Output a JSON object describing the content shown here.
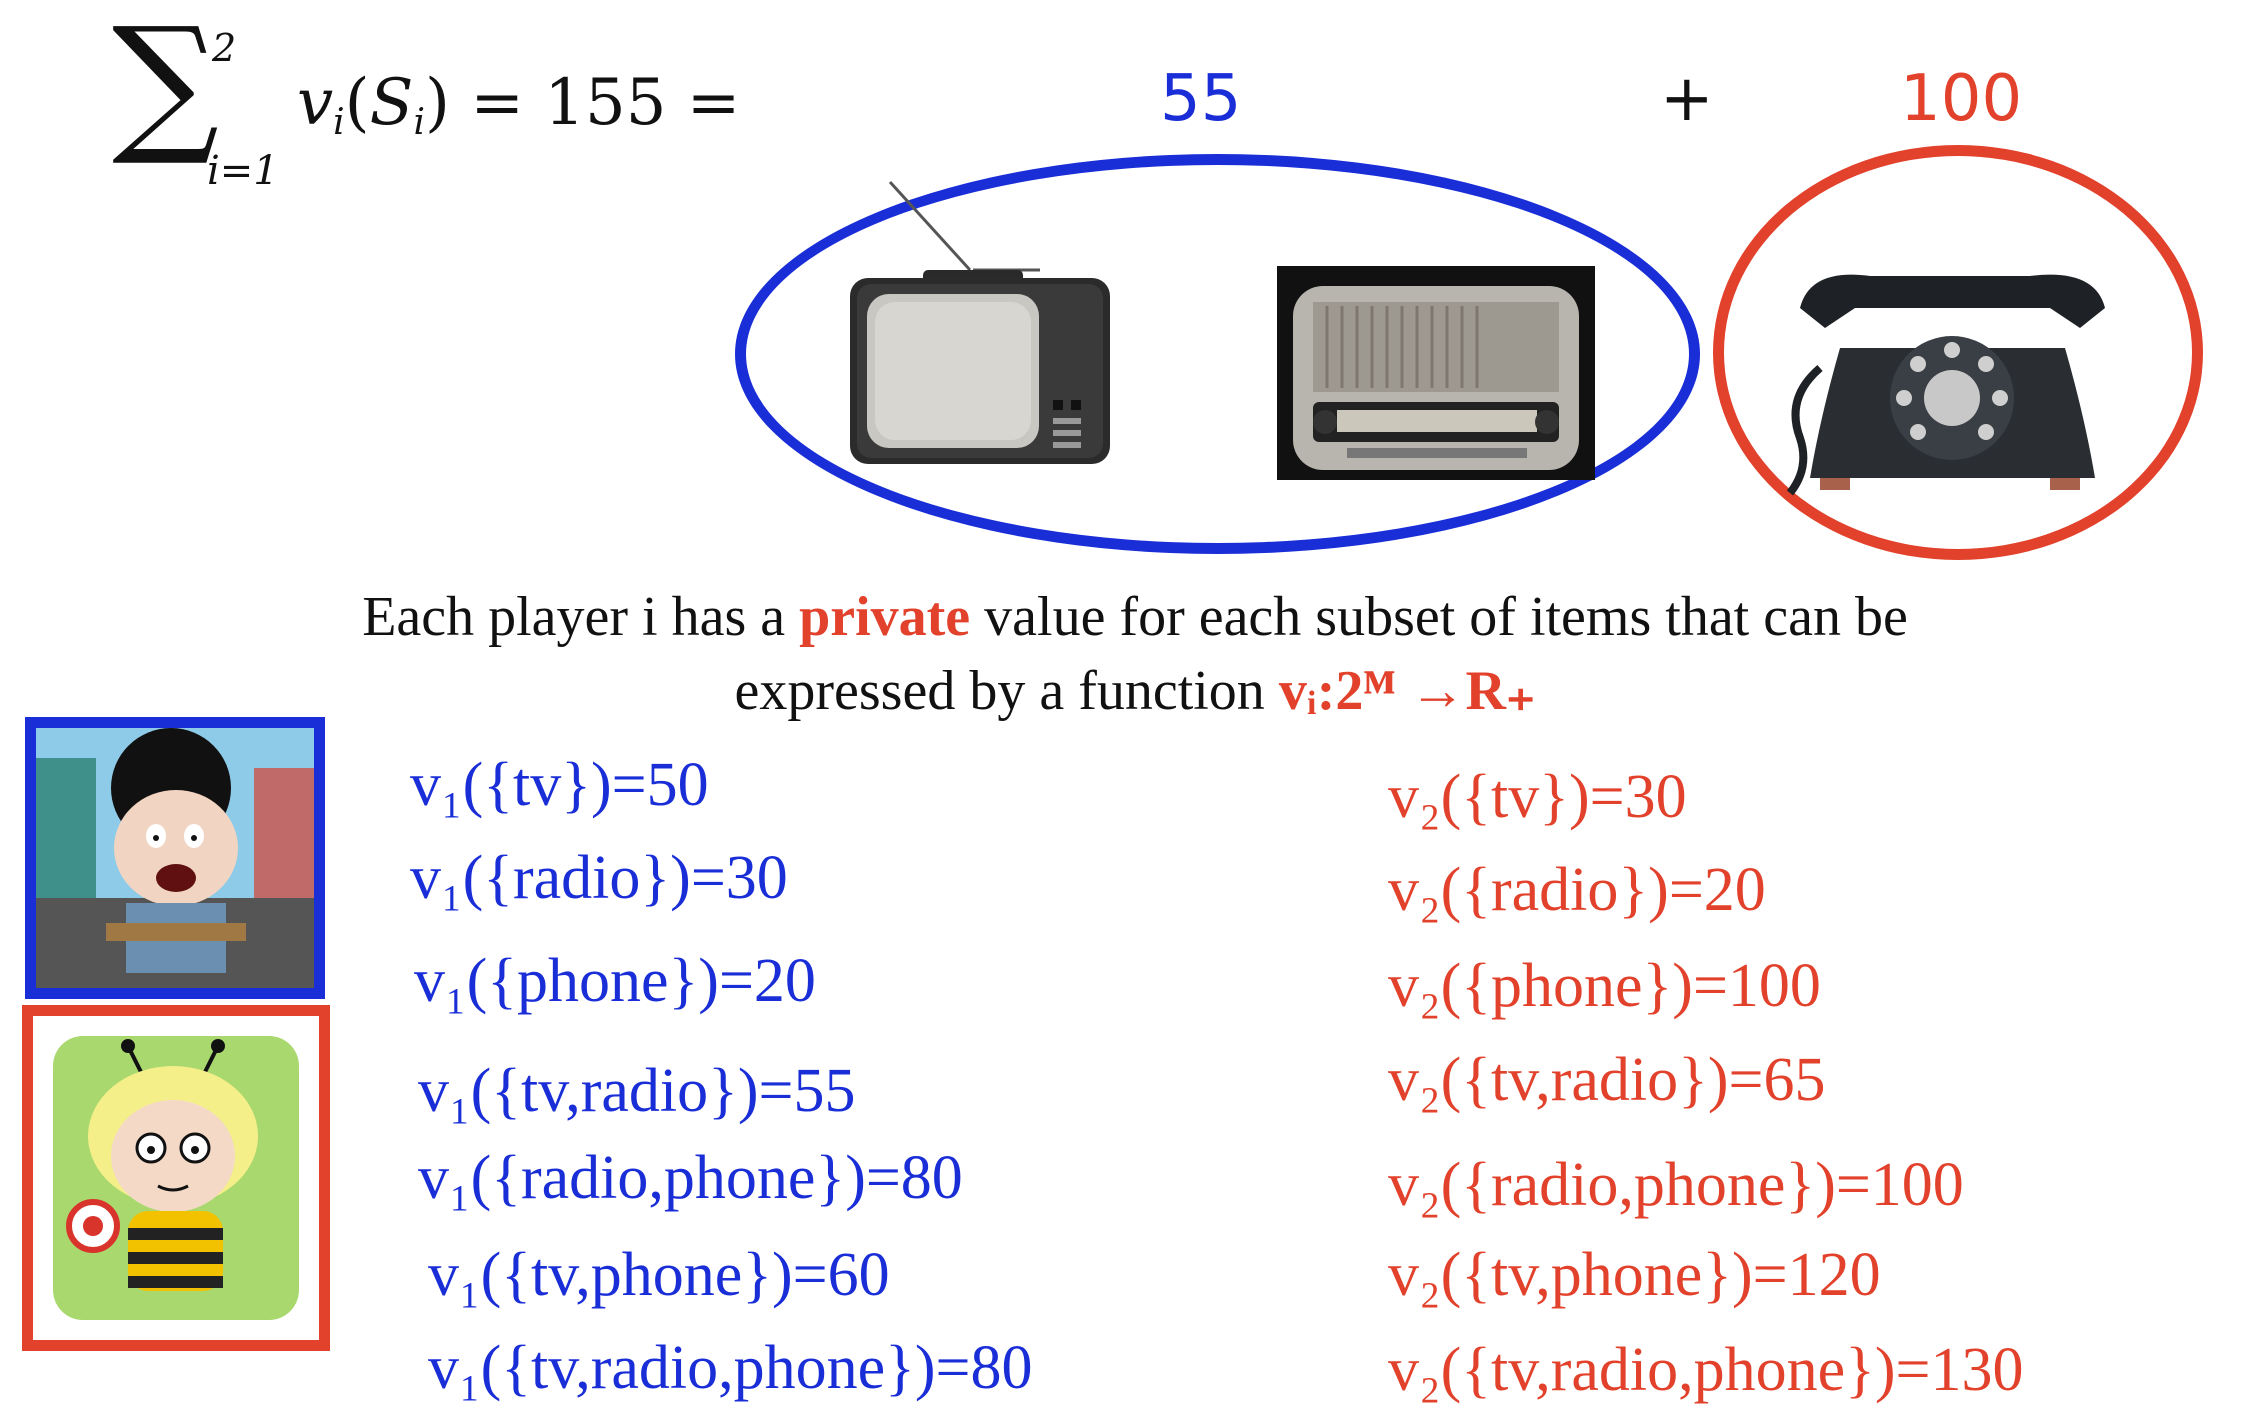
{
  "formula": {
    "sigma": "∑",
    "upper": "2",
    "lower": "i=1",
    "v": "v",
    "v_sub": "i",
    "S": "S",
    "S_sub": "i",
    "rest": " = 155 ="
  },
  "group_values": {
    "blue_value": "55",
    "plus": "+",
    "red_value": "100"
  },
  "caption": {
    "part1": "Each player i has a ",
    "highlight": "private",
    "part2": " value for each subset of items that can be",
    "line2": "expressed by a function ",
    "function": "vᵢ:2ᴹ →R₊"
  },
  "player1_values": [
    "v₁({tv})=50",
    "v₁({radio})=30",
    "v₁({phone})=20",
    "v₁({tv,radio})=55",
    "v₁({radio,phone})=80",
    "v₁({tv,phone})=60",
    "v₁({tv,radio,phone})=80"
  ],
  "player2_values": [
    "v₂({tv})=30",
    "v₂({radio})=20",
    "v₂({phone})=100",
    "v₂({tv,radio})=65",
    "v₂({radio,phone})=100",
    "v₂({tv,phone})=120",
    "v₂({tv,radio,phone})=130"
  ],
  "colors": {
    "player1": "#1a2ed8",
    "player2": "#e2412b"
  },
  "icons": [
    "tv-icon",
    "radio-icon",
    "phone-icon",
    "player1-avatar",
    "player2-avatar"
  ]
}
